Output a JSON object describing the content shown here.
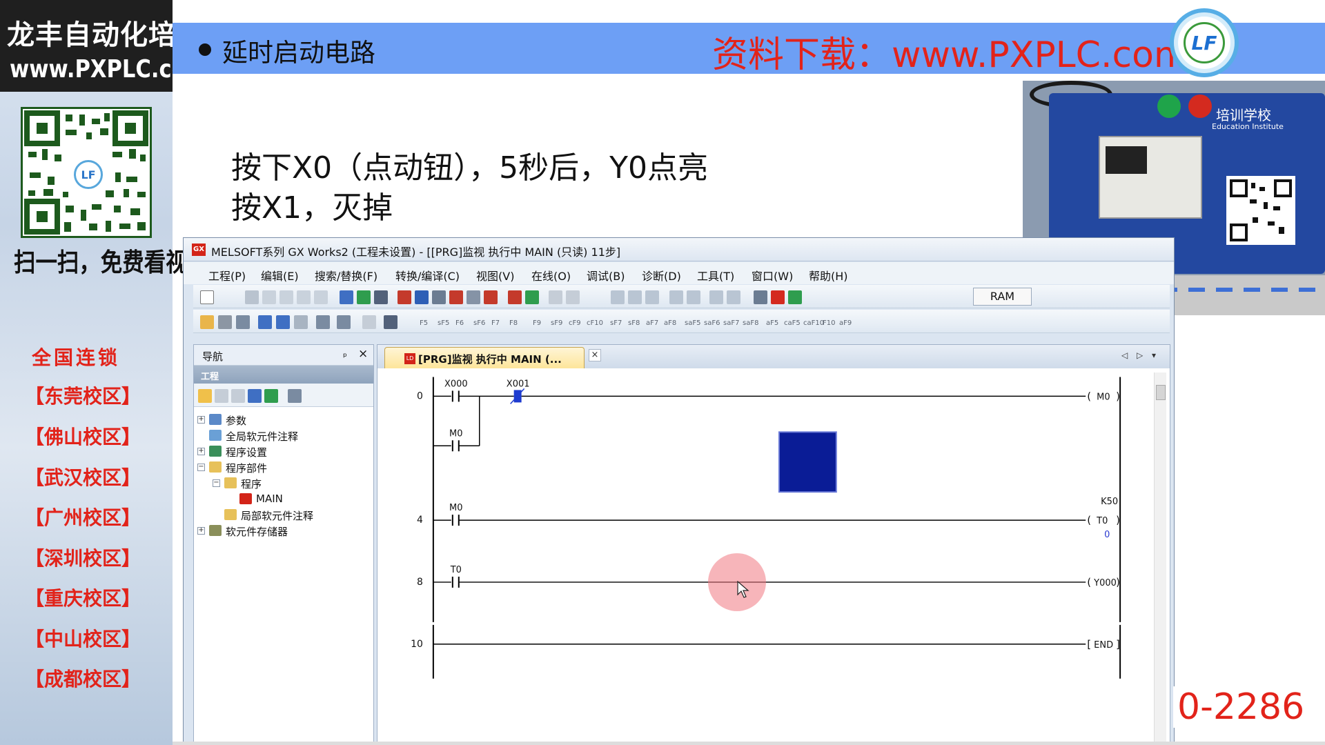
{
  "sidebar": {
    "brand_line1": "龙丰自动化培训中心",
    "brand_line2": "www.PXPLC.com",
    "scan_text": "扫一扫，免费看视频",
    "chain_title": "全国连锁",
    "campuses": [
      "【东莞校区】",
      "【佛山校区】",
      "【武汉校区】",
      "【广州校区】",
      "【深圳校区】",
      "【重庆校区】",
      "【中山校区】",
      "【成都校区】"
    ]
  },
  "header": {
    "title": "延时启动电路",
    "download": "资料下载：www.PXPLC.com",
    "logo_text": "LF"
  },
  "problem": {
    "line1": "按下X0（点动钮），5秒后，Y0点亮",
    "line2": "按X1，灭掉"
  },
  "photo": {
    "school_text": "培训学校",
    "institute_text": "Education Institute"
  },
  "window": {
    "title": "MELSOFT系列 GX Works2 (工程未设置) - [[PRG]监视 执行中 MAIN (只读) 11步]",
    "menus": [
      "工程(P)",
      "编辑(E)",
      "搜索/替换(F)",
      "转换/编译(C)",
      "视图(V)",
      "在线(O)",
      "调试(B)",
      "诊断(D)",
      "工具(T)",
      "窗口(W)",
      "帮助(H)"
    ],
    "ram_label": "RAM",
    "toolbar_keys": [
      "F5",
      "sF5",
      "F6",
      "sF6",
      "F7",
      "F8",
      "F9",
      "sF9",
      "cF9",
      "cF10",
      "sF7",
      "sF8",
      "aF7",
      "aF8",
      "saF5",
      "saF6",
      "saF7",
      "saF8",
      "aF5",
      "caF5",
      "caF10",
      "F10",
      "aF9"
    ]
  },
  "navigation": {
    "title": "导航",
    "pin": "ₚ",
    "close": "×",
    "project_label": "工程",
    "tree": [
      "参数",
      "全局软元件注释",
      "程序设置",
      "程序部件",
      "程序",
      "MAIN",
      "局部软元件注释",
      "软元件存储器"
    ]
  },
  "ladder_tab": {
    "label": "[PRG]监视 执行中 MAIN (...",
    "close": "×"
  },
  "ladder": {
    "step_numbers": [
      "0",
      "4",
      "8",
      "10"
    ],
    "contacts": [
      "X000",
      "X001",
      "M0",
      "M0",
      "T0"
    ],
    "coils": [
      "M0",
      "T0",
      "Y000"
    ],
    "timer_setting": "K50",
    "timer_current": "0",
    "end_label": "END"
  },
  "footer": {
    "phone_partial": "0-2286"
  },
  "colors": {
    "title_bar": "#6d9ff5",
    "accent_red": "#e2231a",
    "monitor_block": "#0a1c96",
    "contact_on": "#1e3cd0"
  }
}
